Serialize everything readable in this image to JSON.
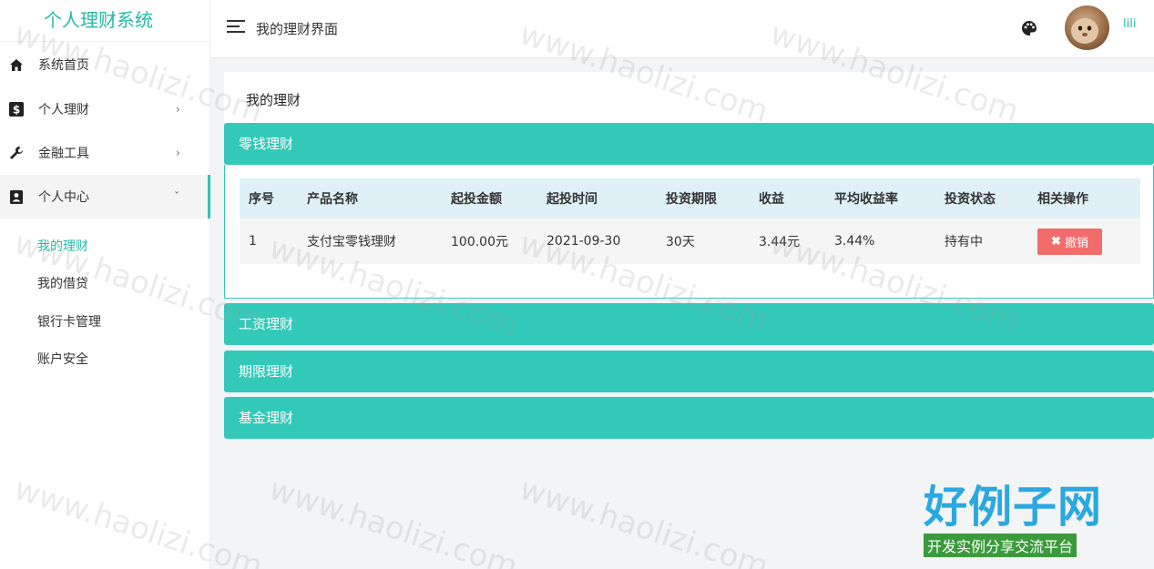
{
  "app": {
    "title": "个人理财系统"
  },
  "header": {
    "page_title": "我的理财界面",
    "username": "lili"
  },
  "sidebar": {
    "items": [
      {
        "label": "系统首页",
        "icon": "home-icon"
      },
      {
        "label": "个人理财",
        "icon": "dollar-icon"
      },
      {
        "label": "金融工具",
        "icon": "wrench-icon"
      },
      {
        "label": "个人中心",
        "icon": "contact-card-icon"
      }
    ],
    "sub_items": [
      {
        "label": "我的理财"
      },
      {
        "label": "我的借贷"
      },
      {
        "label": "银行卡管理"
      },
      {
        "label": "账户安全"
      }
    ]
  },
  "main": {
    "card_title": "我的理财",
    "panels": [
      {
        "label": "零钱理财"
      },
      {
        "label": "工资理财"
      },
      {
        "label": "期限理财"
      },
      {
        "label": "基金理财"
      }
    ],
    "table": {
      "columns": [
        "序号",
        "产品名称",
        "起投金额",
        "起投时间",
        "投资期限",
        "收益",
        "平均收益率",
        "投资状态",
        "相关操作"
      ],
      "rows": [
        {
          "index": "1",
          "product": "支付宝零钱理财",
          "amount": "100.00元",
          "start": "2021-09-30",
          "term": "30天",
          "income": "3.44元",
          "rate": "3.44%",
          "status": "持有中",
          "action": "撤销"
        }
      ]
    }
  },
  "watermark": {
    "text": "www.haolizi.com",
    "brand": "好例子网",
    "brand_sub": "开发实例分享交流平台"
  },
  "colors": {
    "accent": "#33c9b9",
    "danger": "#f36c6c"
  }
}
